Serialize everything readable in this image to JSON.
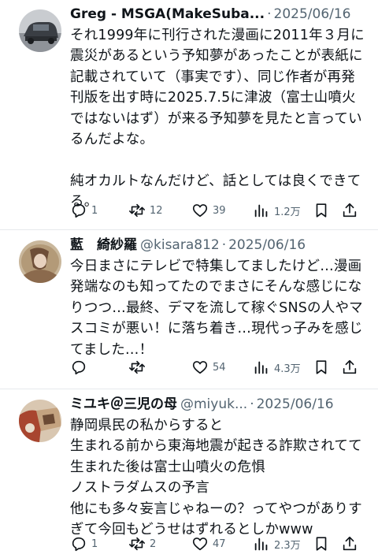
{
  "tweets": [
    {
      "name": "Greg - MSGA(MakeSuba...",
      "handle": "",
      "date": "2025/06/16",
      "text": "それ1999年に刊行された漫画に2011年３月に\n震災があるという予知夢があったことが表紙に\n記載されていて（事実です）、同じ作者が再発\n刊版を出す時に2025.7.5に津波（富士山噴火\nではないはず）が来る予知夢を見たと言ってい\nるんだよな。\n\n純オカルトなんだけど、話としては良くできて\nる。",
      "replies": "1",
      "retweets": "12",
      "likes": "39",
      "views": "1.2万"
    },
    {
      "name": "藍　綺紗羅",
      "handle": "@kisara812",
      "date": "2025/06/16",
      "text": "今日まさにテレビで特集してましたけど…漫画\n発端なのも知ってたのでまさにそんな感じにな\nりつつ…最終、デマを流して稼ぐSNSの人やマ\nスコミが悪い！に落ち着き…現代っ子みを感じ\nてました…！",
      "replies": "",
      "retweets": "",
      "likes": "54",
      "views": "4.3万"
    },
    {
      "name": "ミユキ＠三児の母",
      "handle": "@miyuk...",
      "date": "2025/06/16",
      "text": "静岡県民の私からすると\n生まれる前から東海地震が起きる詐欺されてて\n生まれた後は富士山噴火の危惧\nノストラダムスの予言\n他にも多々妄言じゃねーの？ってやつがありす\nぎて今回もどうせはずれるとしかwww",
      "replies": "1",
      "retweets": "2",
      "likes": "47",
      "views": "2.3万"
    }
  ],
  "icons": [
    "reply-icon",
    "retweet-icon",
    "like-icon",
    "views-icon",
    "bookmark-icon",
    "share-icon"
  ],
  "colors": {
    "text": "#0f1419",
    "secondary": "#536471",
    "divider": "#e6e9ec"
  }
}
